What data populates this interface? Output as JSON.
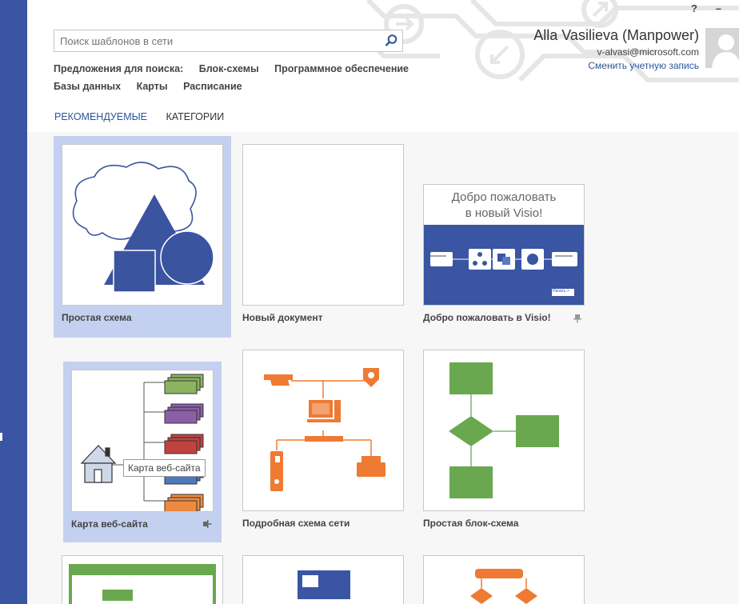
{
  "window": {
    "help": "?",
    "minimize": "–"
  },
  "search": {
    "placeholder": "Поиск шаблонов в сети",
    "value": ""
  },
  "suggestions": {
    "label": "Предложения для поиска:",
    "items": [
      "Блок-схемы",
      "Программное обеспечение",
      "Базы данных",
      "Карты",
      "Расписание"
    ]
  },
  "user": {
    "name": "Alla Vasilieva (Manpower)",
    "email": "v-alvasi@microsoft.com",
    "switch_account": "Сменить учетную запись"
  },
  "tabs": [
    {
      "label": "РЕКОМЕНДУЕМЫЕ",
      "active": true
    },
    {
      "label": "КАТЕГОРИИ",
      "active": false
    }
  ],
  "templates": [
    {
      "label": "Простая схема"
    },
    {
      "label": "Новый документ"
    },
    {
      "label": "Добро пожаловать в Visio!"
    },
    {
      "label": "Карта веб-сайта"
    },
    {
      "label": "Подробная схема сети"
    },
    {
      "label": "Простая блок-схема"
    }
  ],
  "welcome_thumb": {
    "line1": "Добро пожаловать",
    "line2": "в новый Visio!",
    "start": "Начать >"
  },
  "tooltip": "Карта веб-сайта",
  "colors": {
    "accent": "#3955a3",
    "link": "#2a5699",
    "selected_card": "#c4d0ef",
    "green": "#6aa84f",
    "orange": "#ee7a33"
  }
}
